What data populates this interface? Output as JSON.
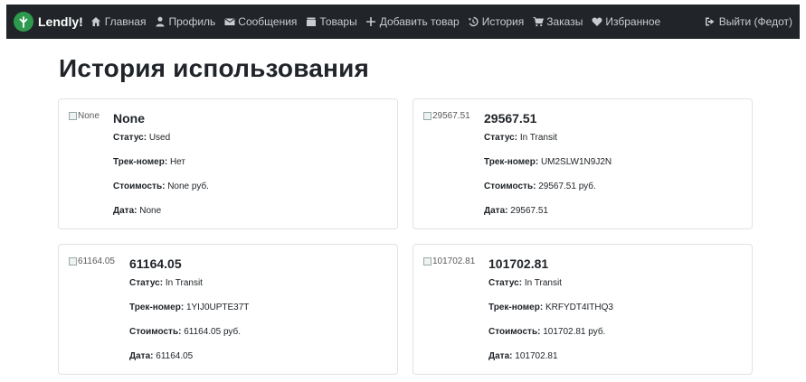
{
  "navbar": {
    "brand": "Lendly!",
    "links": [
      {
        "label": "Главная",
        "icon": "home-icon"
      },
      {
        "label": "Профиль",
        "icon": "user-icon"
      },
      {
        "label": "Сообщения",
        "icon": "envelope-icon"
      },
      {
        "label": "Товары",
        "icon": "box-icon"
      },
      {
        "label": "Добавить товар",
        "icon": "plus-icon"
      },
      {
        "label": "История",
        "icon": "history-icon"
      },
      {
        "label": "Заказы",
        "icon": "cart-icon"
      },
      {
        "label": "Избранное",
        "icon": "heart-icon"
      }
    ],
    "logout": {
      "label": "Выйти (Федот)",
      "icon": "logout-icon"
    }
  },
  "page": {
    "title": "История использования"
  },
  "labels": {
    "status": "Статус:",
    "tracking": "Трек-номер:",
    "cost": "Стоимость:",
    "date": "Дата:"
  },
  "cards": [
    {
      "img_alt": "None",
      "title": "None",
      "status": "Used",
      "tracking": "Нет",
      "cost": "None руб.",
      "date": "None"
    },
    {
      "img_alt": "29567.51",
      "title": "29567.51",
      "status": "In Transit",
      "tracking": "UM2SLW1N9J2N",
      "cost": "29567.51 руб.",
      "date": "29567.51"
    },
    {
      "img_alt": "61164.05",
      "title": "61164.05",
      "status": "In Transit",
      "tracking": "1YIJ0UPTE37T",
      "cost": "61164.05 руб.",
      "date": "61164.05"
    },
    {
      "img_alt": "101702.81",
      "title": "101702.81",
      "status": "In Transit",
      "tracking": "KRFYDT4ITHQ3",
      "cost": "101702.81 руб.",
      "date": "101702.81"
    }
  ]
}
